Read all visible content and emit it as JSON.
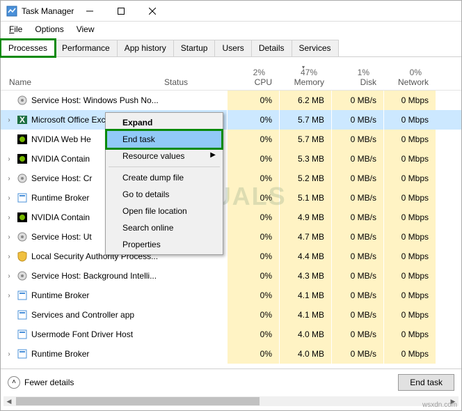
{
  "window": {
    "title": "Task Manager"
  },
  "menu": {
    "file": "File",
    "options": "Options",
    "view": "View"
  },
  "tabs": {
    "processes": "Processes",
    "performance": "Performance",
    "apphistory": "App history",
    "startup": "Startup",
    "users": "Users",
    "details": "Details",
    "services": "Services"
  },
  "headers": {
    "name": "Name",
    "status": "Status",
    "cpu_pct": "2%",
    "cpu": "CPU",
    "mem_pct": "47%",
    "mem": "Memory",
    "disk_pct": "1%",
    "disk": "Disk",
    "net_pct": "0%",
    "net": "Network"
  },
  "rows": [
    {
      "exp": false,
      "icon": "gear",
      "name": "Service Host: Windows Push No...",
      "cpu": "0%",
      "mem": "6.2 MB",
      "disk": "0 MB/s",
      "net": "0 Mbps",
      "sel": false
    },
    {
      "exp": true,
      "icon": "excel",
      "name": "Microsoft Office Excel (32 bit)",
      "cpu": "0%",
      "mem": "5.7 MB",
      "disk": "0 MB/s",
      "net": "0 Mbps",
      "sel": true
    },
    {
      "exp": false,
      "icon": "nvidia",
      "name": "NVIDIA Web He",
      "cpu": "0%",
      "mem": "5.7 MB",
      "disk": "0 MB/s",
      "net": "0 Mbps",
      "sel": false
    },
    {
      "exp": true,
      "icon": "nvidia",
      "name": "NVIDIA Contain",
      "cpu": "0%",
      "mem": "5.3 MB",
      "disk": "0 MB/s",
      "net": "0 Mbps",
      "sel": false
    },
    {
      "exp": true,
      "icon": "gear",
      "name": "Service Host: Cr",
      "cpu": "0%",
      "mem": "5.2 MB",
      "disk": "0 MB/s",
      "net": "0 Mbps",
      "sel": false
    },
    {
      "exp": true,
      "icon": "app",
      "name": "Runtime Broker",
      "cpu": "0%",
      "mem": "5.1 MB",
      "disk": "0 MB/s",
      "net": "0 Mbps",
      "sel": false
    },
    {
      "exp": true,
      "icon": "nvidia",
      "name": "NVIDIA Contain",
      "cpu": "0%",
      "mem": "4.9 MB",
      "disk": "0 MB/s",
      "net": "0 Mbps",
      "sel": false
    },
    {
      "exp": true,
      "icon": "gear",
      "name": "Service Host: Ut",
      "cpu": "0%",
      "mem": "4.7 MB",
      "disk": "0 MB/s",
      "net": "0 Mbps",
      "sel": false
    },
    {
      "exp": true,
      "icon": "shield",
      "name": "Local Security Authority Process...",
      "cpu": "0%",
      "mem": "4.4 MB",
      "disk": "0 MB/s",
      "net": "0 Mbps",
      "sel": false
    },
    {
      "exp": true,
      "icon": "gear",
      "name": "Service Host: Background Intelli...",
      "cpu": "0%",
      "mem": "4.3 MB",
      "disk": "0 MB/s",
      "net": "0 Mbps",
      "sel": false
    },
    {
      "exp": true,
      "icon": "app",
      "name": "Runtime Broker",
      "cpu": "0%",
      "mem": "4.1 MB",
      "disk": "0 MB/s",
      "net": "0 Mbps",
      "sel": false
    },
    {
      "exp": false,
      "icon": "app",
      "name": "Services and Controller app",
      "cpu": "0%",
      "mem": "4.1 MB",
      "disk": "0 MB/s",
      "net": "0 Mbps",
      "sel": false
    },
    {
      "exp": false,
      "icon": "app",
      "name": "Usermode Font Driver Host",
      "cpu": "0%",
      "mem": "4.0 MB",
      "disk": "0 MB/s",
      "net": "0 Mbps",
      "sel": false
    },
    {
      "exp": true,
      "icon": "app",
      "name": "Runtime Broker",
      "cpu": "0%",
      "mem": "4.0 MB",
      "disk": "0 MB/s",
      "net": "0 Mbps",
      "sel": false
    }
  ],
  "context_menu": {
    "expand": "Expand",
    "end_task": "End task",
    "resource_values": "Resource values",
    "create_dump": "Create dump file",
    "go_to_details": "Go to details",
    "open_file_loc": "Open file location",
    "search_online": "Search online",
    "properties": "Properties"
  },
  "footer": {
    "fewer": "Fewer details",
    "end_task": "End task"
  },
  "watermark": "A   PUALS",
  "credit": "wsxdn.com"
}
